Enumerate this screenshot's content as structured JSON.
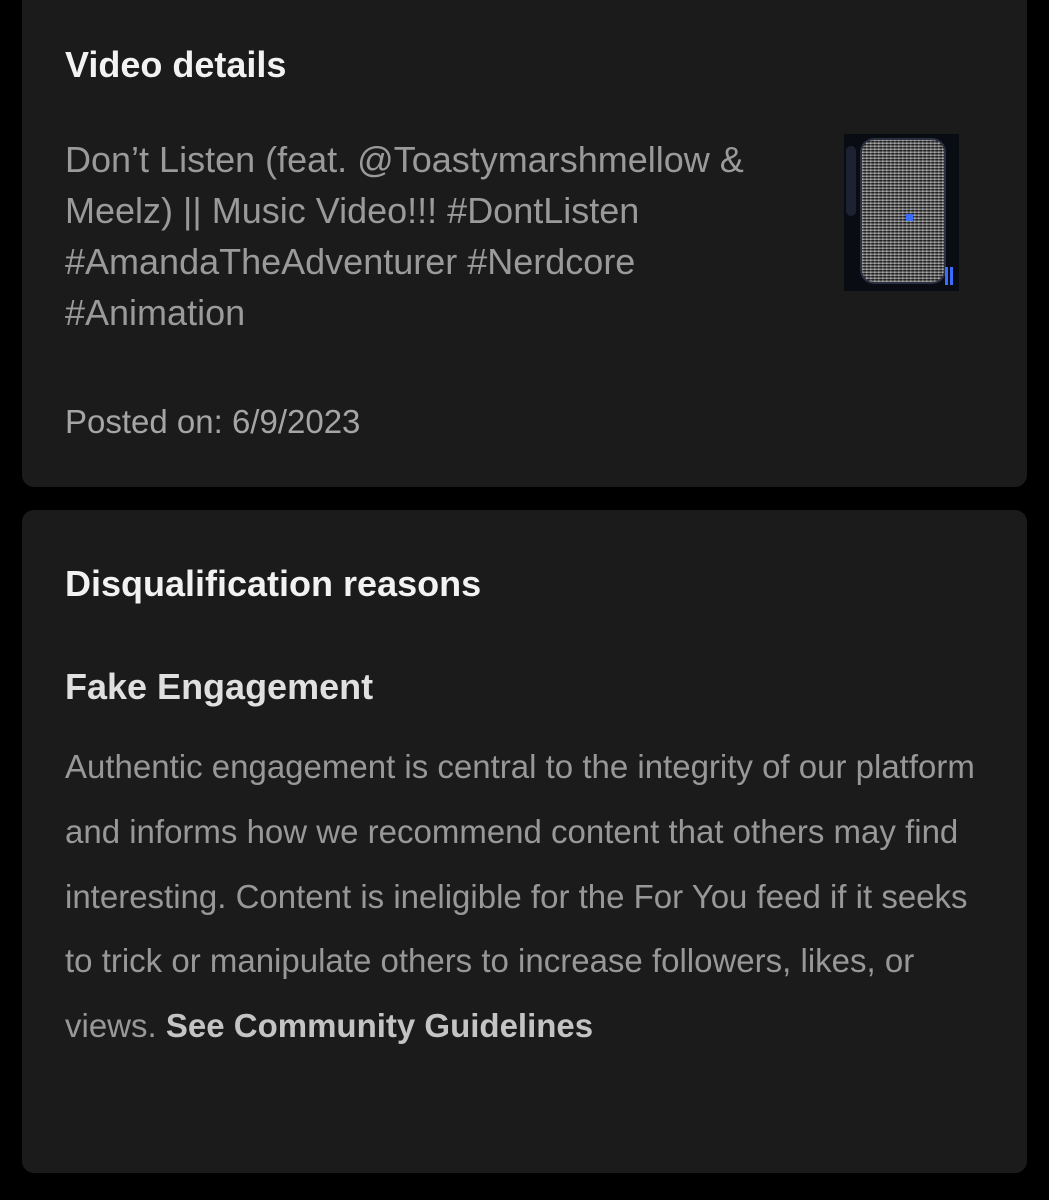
{
  "video_details": {
    "heading": "Video details",
    "title": "Don’t Listen (feat. @Toastymarshmellow & Meelz) || Music Video!!! #DontListen #AmandaTheAdventurer #Nerdcore #Animation",
    "posted_on": "Posted on: 6/9/2023"
  },
  "disqualification": {
    "heading": "Disqualification reasons",
    "reason_title": "Fake Engagement",
    "reason_body": "Authentic engagement is central to the integrity of our platform and informs how we recommend content that others may find interesting. Content is ineligible for the For You feed if it seeks to trick or manipulate others to increase followers, likes, or views.",
    "link_label": "See Community Guidelines"
  },
  "colors": {
    "page_background": "#000000",
    "card_background": "#1b1b1b",
    "heading_text": "#f2f2f2",
    "secondary_text": "#9a9a9a",
    "link_text": "#c4c4c4"
  }
}
